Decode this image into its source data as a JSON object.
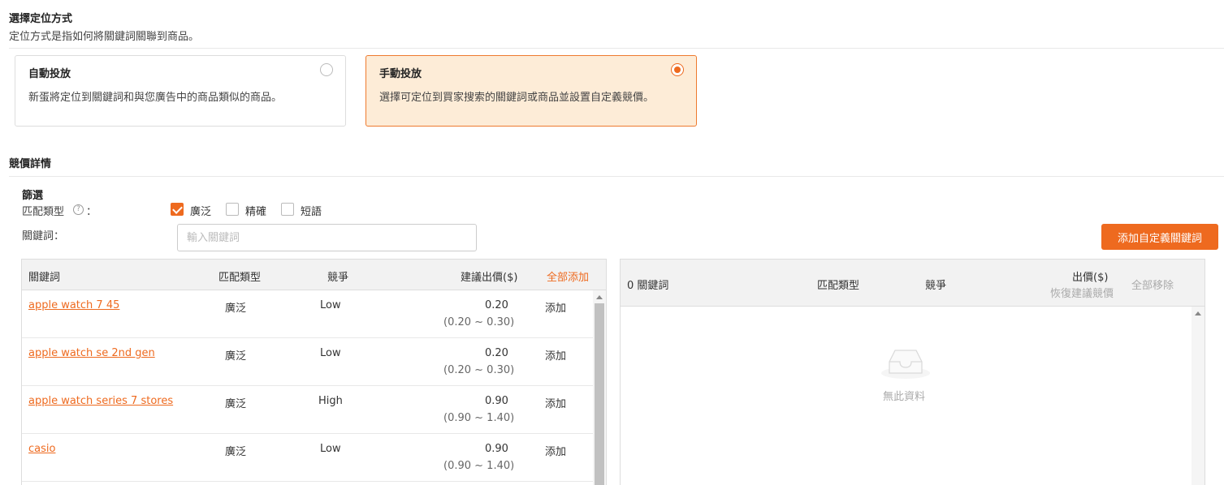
{
  "targeting": {
    "heading": "選擇定位方式",
    "description": "定位方式是指如何將關鍵詞關聯到商品。",
    "options": [
      {
        "title": "自動投放",
        "description": "新蛋將定位到關鍵詞和與您廣告中的商品類似的商品。",
        "selected": false
      },
      {
        "title": "手動投放",
        "description": "選擇可定位到買家搜索的關鍵詞或商品並設置自定義競價。",
        "selected": true
      }
    ]
  },
  "bidding": {
    "heading": "競價詳情",
    "filter": {
      "heading": "篩選",
      "match_type_label": "匹配類型",
      "colon": "：",
      "help_icon": "question-circle-icon",
      "match_types": [
        {
          "label": "廣泛",
          "checked": true
        },
        {
          "label": "精確",
          "checked": false
        },
        {
          "label": "短語",
          "checked": false
        }
      ],
      "keyword_label": "關鍵詞：",
      "keyword_placeholder": "輸入關鍵詞",
      "keyword_value": ""
    },
    "add_custom_button": "添加自定義關鍵詞"
  },
  "suggested_table": {
    "headers": {
      "keyword": "關鍵詞",
      "match_type": "匹配類型",
      "competition": "競爭",
      "suggested_bid": "建議出價($)",
      "add_all": "全部添加"
    },
    "rows": [
      {
        "keyword": "apple watch 7 45",
        "match_type": "廣泛",
        "competition": "Low",
        "bid": "0.20",
        "range": "(0.20 ~ 0.30)",
        "action": "添加"
      },
      {
        "keyword": "apple watch se 2nd gen",
        "match_type": "廣泛",
        "competition": "Low",
        "bid": "0.20",
        "range": "(0.20 ~ 0.30)",
        "action": "添加"
      },
      {
        "keyword": "apple watch series 7 stores",
        "match_type": "廣泛",
        "competition": "High",
        "bid": "0.90",
        "range": "(0.90 ~ 1.40)",
        "action": "添加"
      },
      {
        "keyword": "casio",
        "match_type": "廣泛",
        "competition": "Low",
        "bid": "0.90",
        "range": "(0.90 ~ 1.40)",
        "action": "添加"
      }
    ]
  },
  "selected_table": {
    "headers": {
      "count": "0 關鍵詞",
      "match_type": "匹配類型",
      "competition": "競爭",
      "bid": "出價($)",
      "restore": "恢復建議競價",
      "remove_all": "全部移除"
    },
    "empty_icon": "empty-inbox-icon",
    "empty_text": "無此資料"
  },
  "colors": {
    "accent": "#ee6a1f",
    "selected_card_bg": "#fdecd7"
  }
}
